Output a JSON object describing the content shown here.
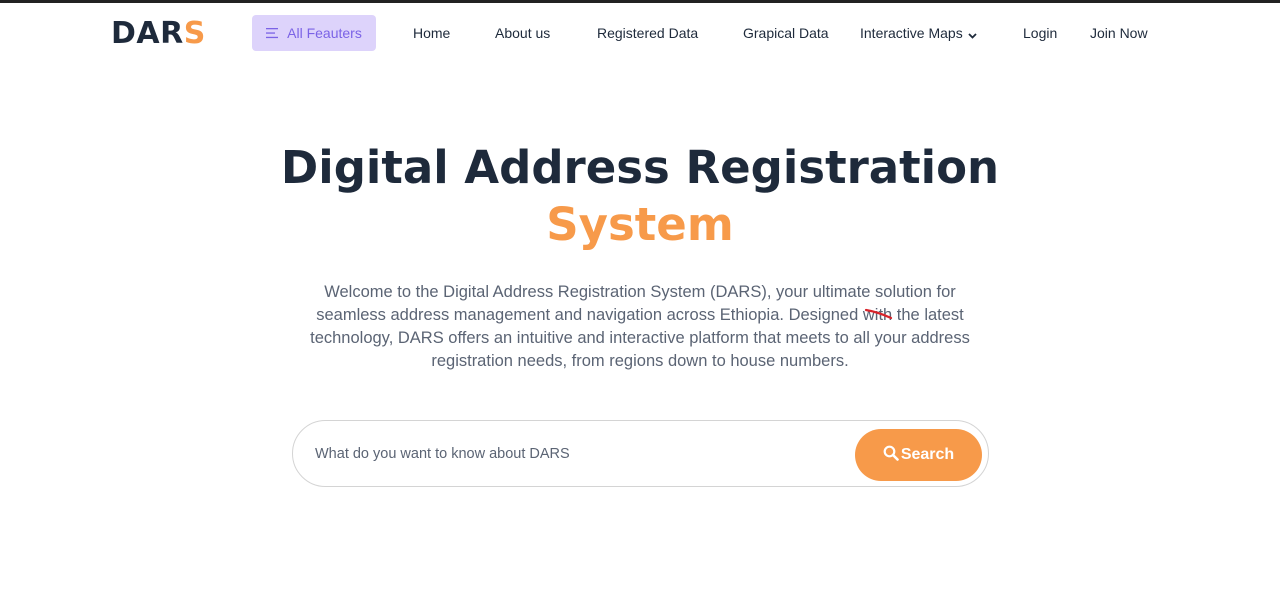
{
  "nav": {
    "logo_main": "DAR",
    "logo_accent": "S",
    "all_features_label": "All Feauters",
    "links": {
      "home": "Home",
      "about": "About us",
      "registered": "Registered Data",
      "graphical": "Grapical Data",
      "maps": "Interactive Maps",
      "login": "Login",
      "join": "Join Now"
    }
  },
  "hero": {
    "title_line1": "Digital Address Registration",
    "title_line2": "System",
    "description": "Welcome to the Digital Address Registration System (DARS), your ultimate solution for seamless address management and navigation across Ethiopia. Designed with the latest technology, DARS offers an intuitive and interactive platform that meets to all your address registration needs, from regions down to house numbers."
  },
  "search": {
    "placeholder": "What do you want to know about DARS",
    "value": "",
    "button_label": "Search"
  },
  "colors": {
    "accent": "#f79a4a",
    "dark": "#1e2a3b",
    "feature_bg": "#ddd3fb",
    "feature_text": "#7b63e6"
  }
}
